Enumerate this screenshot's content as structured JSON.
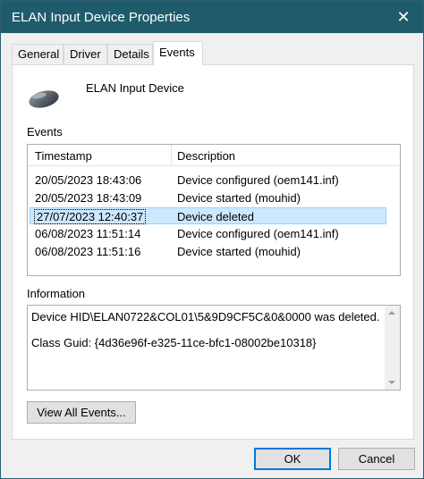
{
  "window": {
    "title": "ELAN Input Device Properties",
    "close_glyph": "✕"
  },
  "tabs": [
    {
      "label": "General",
      "active": false
    },
    {
      "label": "Driver",
      "active": false
    },
    {
      "label": "Details",
      "active": false
    },
    {
      "label": "Events",
      "active": true
    }
  ],
  "device": {
    "name": "ELAN Input Device",
    "icon": "mouse-icon"
  },
  "events": {
    "label": "Events",
    "columns": [
      "Timestamp",
      "Description"
    ],
    "rows": [
      {
        "timestamp": "20/05/2023 18:43:06",
        "description": "Device configured (oem141.inf)"
      },
      {
        "timestamp": "20/05/2023 18:43:09",
        "description": "Device started (mouhid)"
      },
      {
        "timestamp": "27/07/2023 12:40:37",
        "description": "Device deleted"
      },
      {
        "timestamp": "06/08/2023 11:51:14",
        "description": "Device configured (oem141.inf)"
      },
      {
        "timestamp": "06/08/2023 11:51:16",
        "description": "Device started (mouhid)"
      }
    ],
    "selected_index": 2
  },
  "information": {
    "label": "Information",
    "line1": "Device HID\\ELAN0722&COL01\\5&9D9CF5C&0&0000 was deleted.",
    "line2": "Class Guid: {4d36e96f-e325-11ce-bfc1-08002be10318}"
  },
  "buttons": {
    "view_all": "View All Events...",
    "ok": "OK",
    "cancel": "Cancel"
  },
  "colors": {
    "titlebar": "#1e5c6b",
    "selection": "#cce8ff",
    "primary_border": "#0078d7"
  }
}
